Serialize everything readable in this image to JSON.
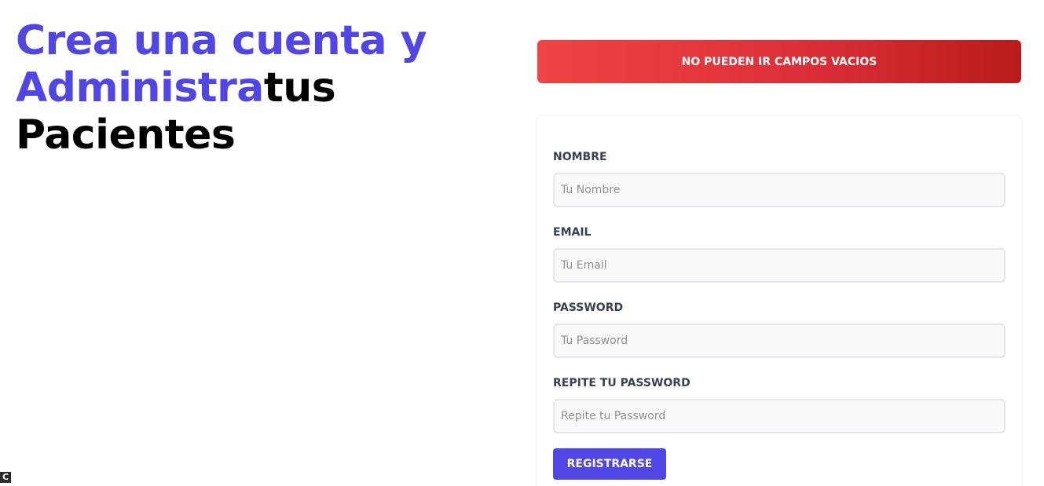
{
  "hero": {
    "line1": "Crea una cuenta y",
    "accent": "Administra",
    "rest": "tus",
    "line3": "Pacientes"
  },
  "alert": {
    "message": "NO PUEDEN IR CAMPOS VACIOS"
  },
  "form": {
    "fields": [
      {
        "label": "NOMBRE",
        "placeholder": "Tu Nombre",
        "value": ""
      },
      {
        "label": "EMAIL",
        "placeholder": "Tu Email",
        "value": ""
      },
      {
        "label": "PASSWORD",
        "placeholder": "Tu Password",
        "value": ""
      },
      {
        "label": "REPITE TU PASSWORD",
        "placeholder": "Repite tu Password",
        "value": ""
      }
    ],
    "submit_label": "REGISTRARSE"
  },
  "corner_badge": "C",
  "colors": {
    "accent": "#4f46e5",
    "alert_start": "#ef4444",
    "alert_end": "#b91c1c"
  }
}
